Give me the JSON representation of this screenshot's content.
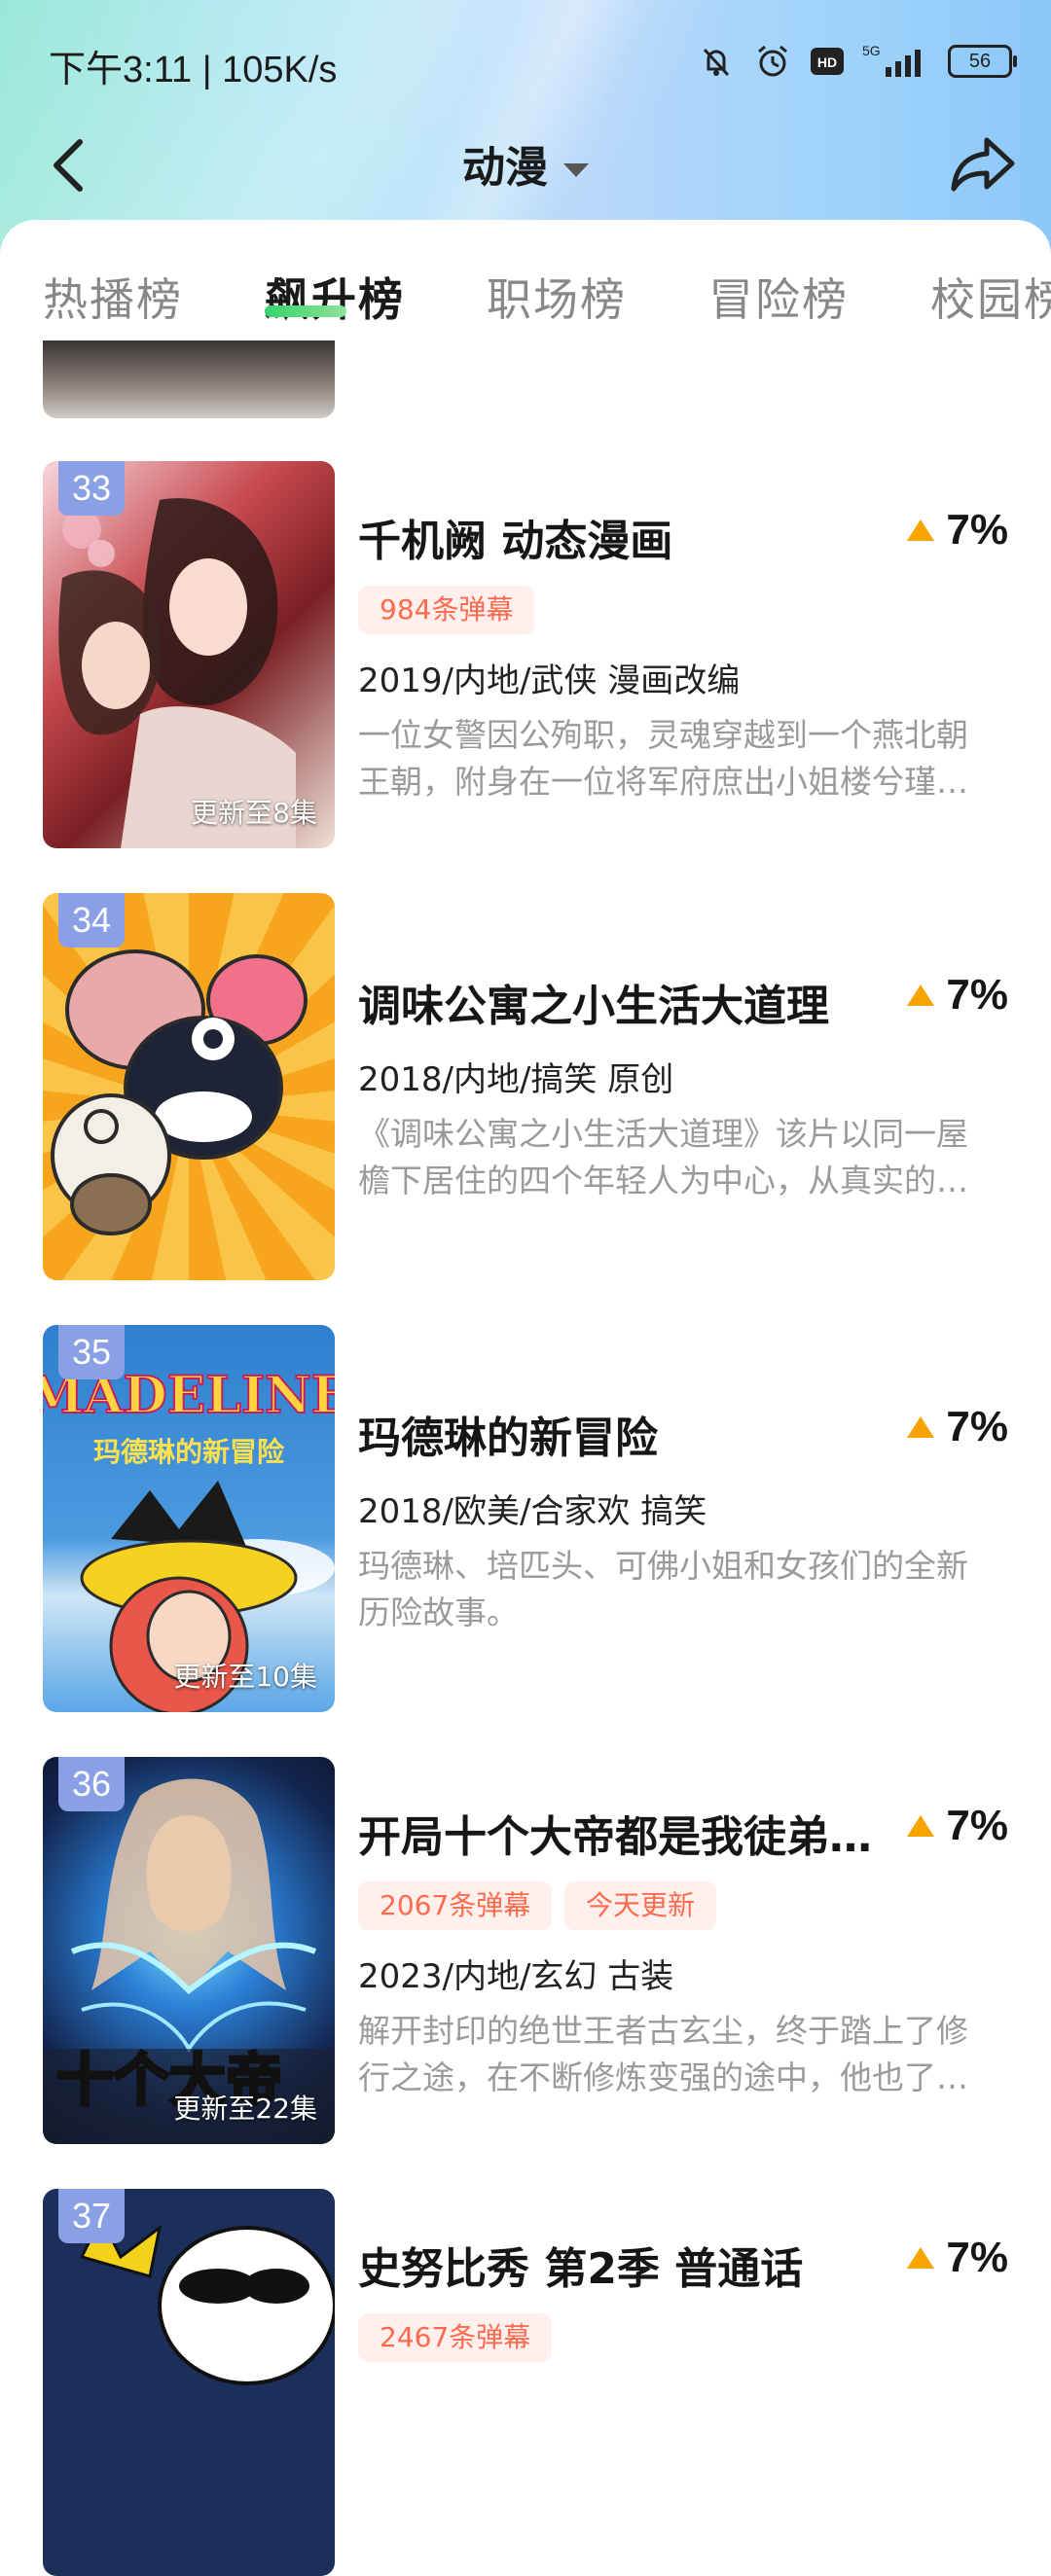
{
  "status": {
    "time": "下午3:11 | 105K/s",
    "battery": "56",
    "network": "5G"
  },
  "nav": {
    "title": "动漫"
  },
  "tabs": [
    {
      "label": "热播榜"
    },
    {
      "label": "飙升榜"
    },
    {
      "label": "职场榜"
    },
    {
      "label": "冒险榜"
    },
    {
      "label": "校园榜"
    }
  ],
  "items": [
    {
      "rank": "33",
      "title": "千机阙 动态漫画",
      "trend": "7%",
      "badges": [
        "984条弹幕"
      ],
      "meta": "2019/内地/武侠 漫画改编",
      "desc1": "一位女警因公殉职，灵魂穿越到一个燕北朝",
      "desc2": "王朝，附身在一位将军府庶出小姐楼兮瑾…",
      "update": "更新至8集"
    },
    {
      "rank": "34",
      "title": "调味公寓之小生活大道理",
      "trend": "7%",
      "badges": [],
      "meta": "2018/内地/搞笑 原创",
      "desc1": "《调味公寓之小生活大道理》该片以同一屋",
      "desc2": "檐下居住的四个年轻人为中心，从真实的…",
      "update": ""
    },
    {
      "rank": "35",
      "title": "玛德琳的新冒险",
      "trend": "7%",
      "badges": [],
      "meta": "2018/欧美/合家欢 搞笑",
      "desc1": "玛德琳、培匹头、可佛小姐和女孩们的全新",
      "desc2": "历险故事。",
      "update": "更新至10集",
      "cover_text1": "MADELINE",
      "cover_text2": "玛德琳的新冒险"
    },
    {
      "rank": "36",
      "title": "开局十个大帝都是我徒弟…",
      "trend": "7%",
      "badges": [
        "2067条弹幕",
        "今天更新"
      ],
      "meta": "2023/内地/玄幻 古装",
      "desc1": "解开封印的绝世王者古玄尘，终于踏上了修",
      "desc2": "行之途，在不断修炼变强的途中，他也了…",
      "update": "更新至22集",
      "cover_text1": "十个大帝"
    },
    {
      "rank": "37",
      "title": "史努比秀 第2季 普通话",
      "trend": "7%",
      "badges": [
        "2467条弹幕"
      ],
      "meta": "",
      "desc1": "",
      "desc2": "",
      "update": ""
    }
  ],
  "colors": {
    "accent": "#36d36a",
    "trend": "#f7a400",
    "badge_text": "#ff6a4d",
    "rank_bg": "#8aa0e6"
  }
}
